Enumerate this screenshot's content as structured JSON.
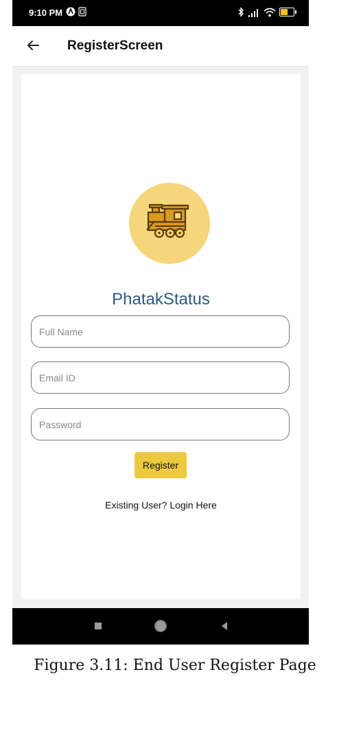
{
  "status_bar": {
    "time": "9:10 PM",
    "battery_level": "49"
  },
  "app_bar": {
    "title": "RegisterScreen"
  },
  "app": {
    "name": "PhatakStatus"
  },
  "form": {
    "full_name_placeholder": "Full Name",
    "email_placeholder": "Email ID",
    "password_placeholder": "Password",
    "register_label": "Register",
    "login_link": "Existing User? Login Here"
  },
  "caption": "Figure 3.11: End User Register Page",
  "colors": {
    "accent_yellow": "#ecc93f",
    "logo_circle": "#f6d67b",
    "title_blue": "#2f5a82",
    "train_brown": "#8a5a12"
  },
  "icons": [
    "back-arrow-icon",
    "train-icon",
    "bluetooth-icon",
    "signal-icon",
    "wifi-icon",
    "battery-icon",
    "recents-icon",
    "home-icon",
    "back-icon"
  ]
}
